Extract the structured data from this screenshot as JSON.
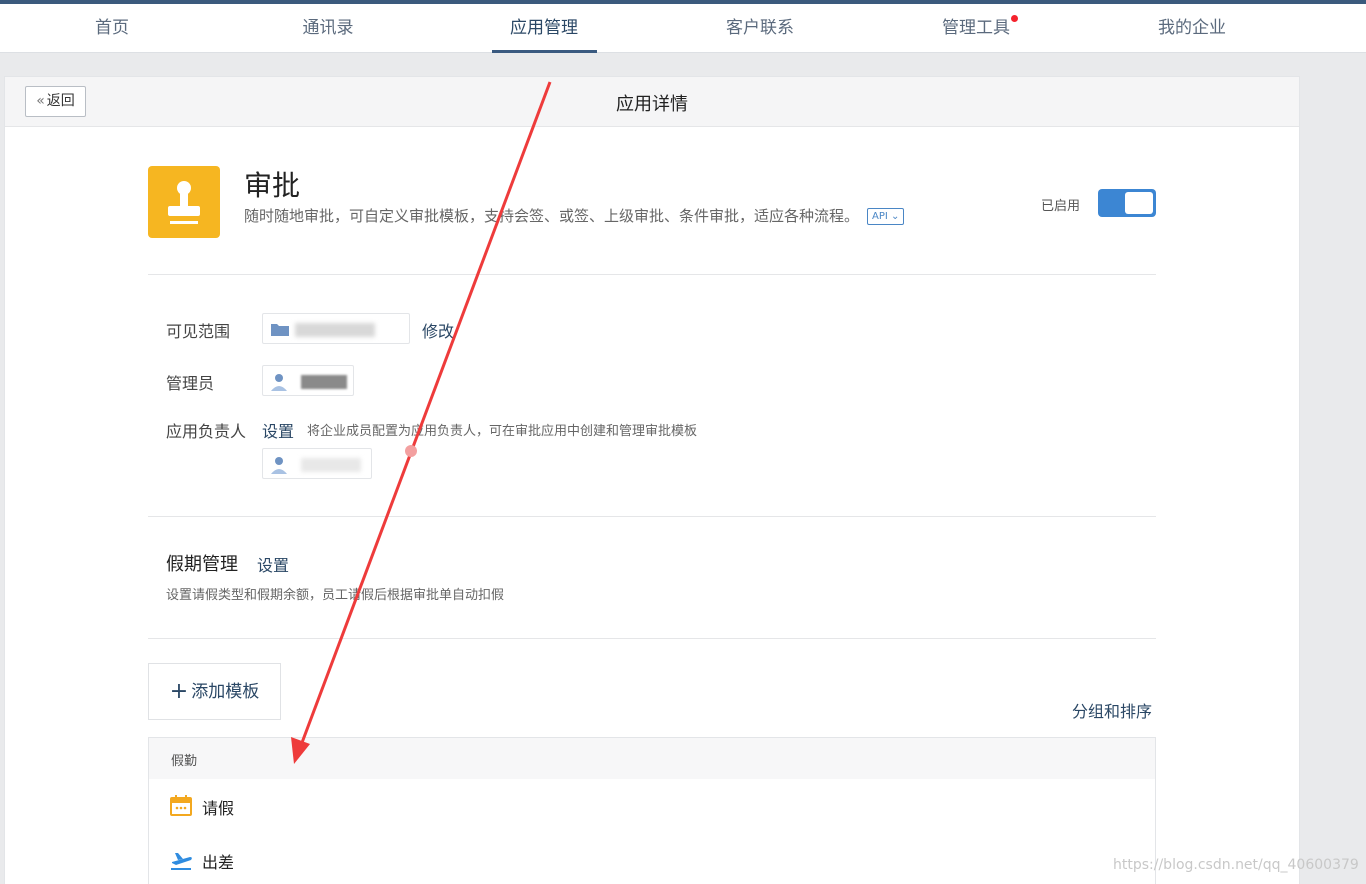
{
  "nav": {
    "items": [
      "首页",
      "通讯录",
      "应用管理",
      "客户联系",
      "管理工具",
      "我的企业"
    ],
    "active_index": 2,
    "notification_on": "管理工具"
  },
  "header": {
    "back_label": "返回",
    "title": "应用详情"
  },
  "app": {
    "name": "审批",
    "description": "随时随地审批，可自定义审批模板，支持会签、或签、上级审批、条件审批，适应各种流程。",
    "api_badge": "API",
    "status_label": "已启用",
    "enabled": true
  },
  "fields": {
    "visible_scope_label": "可见范围",
    "visible_scope_action": "修改",
    "admin_label": "管理员",
    "owner_label": "应用负责人",
    "owner_action": "设置",
    "owner_hint": "将企业成员配置为应用负责人，可在审批应用中创建和管理审批模板"
  },
  "holiday": {
    "title": "假期管理",
    "action": "设置",
    "description": "设置请假类型和假期余额，员工请假后根据审批单自动扣假"
  },
  "templates": {
    "add_label": "添加模板",
    "sort_label": "分组和排序",
    "group_name": "假勤",
    "items": [
      {
        "label": "请假",
        "icon": "calendar-icon"
      },
      {
        "label": "出差",
        "icon": "airplane-icon"
      }
    ]
  },
  "colors": {
    "accent": "#3c86d3",
    "app_icon": "#f6b621",
    "arrow": "#ee3b3b"
  },
  "watermark": "https://blog.csdn.net/qq_40600379"
}
